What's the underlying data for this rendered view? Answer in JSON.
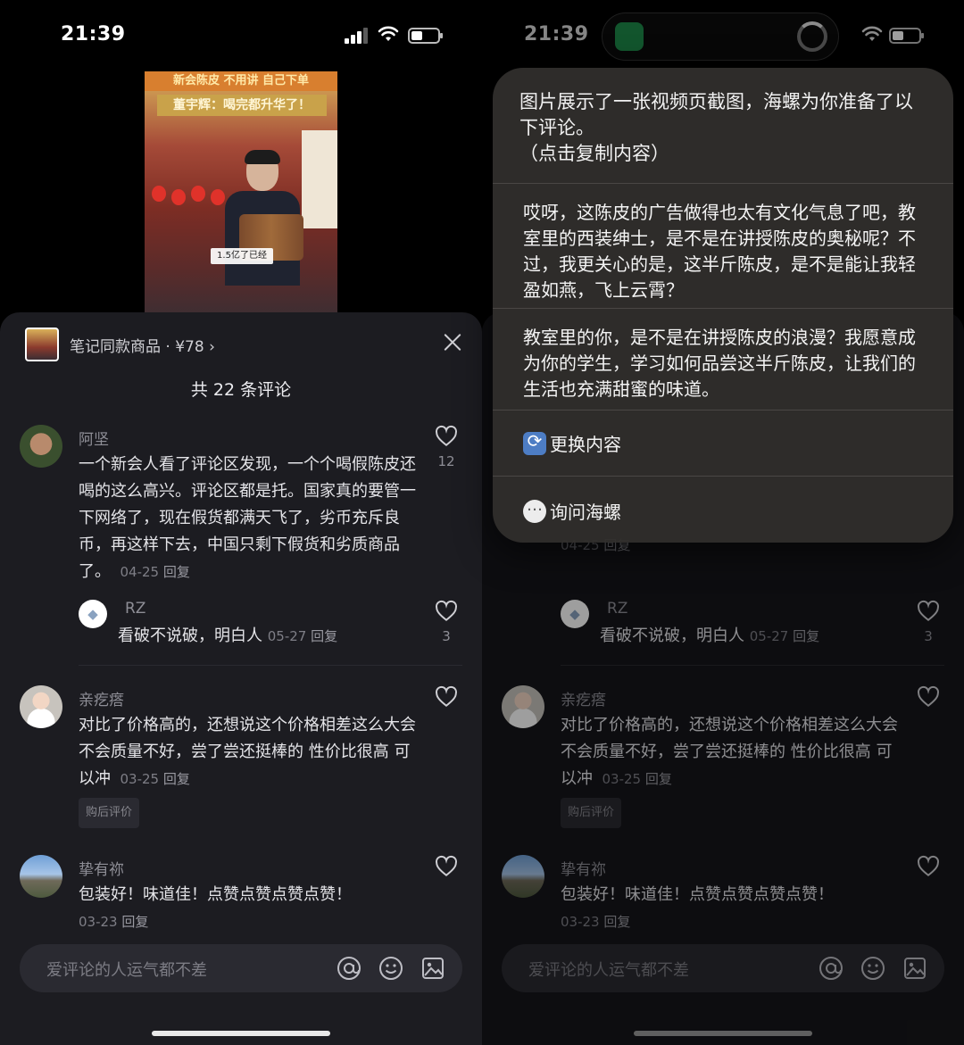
{
  "status": {
    "time": "21:39"
  },
  "video": {
    "banner": "新会陈皮 不用讲 自己下单",
    "title": "董宇辉：喝完都升华了！",
    "caption": "1.5亿了已经"
  },
  "sheet": {
    "product_label": "笔记同款商品 · ¥78 ›",
    "comment_count": "共 22 条评论",
    "comments": [
      {
        "author": "阿坚",
        "text": "一个新会人看了评论区发现，一个个喝假陈皮还喝的这么高兴。评论区都是托。国家真的要管一下网络了，现在假货都满天飞了，劣币充斥良币，再这样下去，中国只剩下假货和劣质商品了。",
        "date": "04-25",
        "reply": "回复",
        "likes": "12"
      },
      {
        "author": "亲疙瘩",
        "text": "对比了价格高的，还想说这个价格相差这么大会不会质量不好，尝了尝还挺棒的 性价比很高 可以冲",
        "date": "03-25",
        "reply": "回复",
        "badge": "购后评价"
      },
      {
        "author": "挚有祢",
        "text": "包装好！味道佳！点赞点赞点赞点赞！",
        "date": "03-23",
        "reply": "回复"
      }
    ],
    "sub_reply": {
      "author": "RZ",
      "text": "看破不说破，明白人",
      "date": "05-27",
      "reply": "回复",
      "likes": "3"
    },
    "input_placeholder": "爱评论的人运气都不差"
  },
  "popup": {
    "header": "图片展示了一张视频页截图，海螺为你准备了以下评论。\n（点击复制内容）",
    "suggestions": [
      "哎呀，这陈皮的广告做得也太有文化气息了吧，教室里的西装绅士，是不是在讲授陈皮的奥秘呢？不过，我更关心的是，这半斤陈皮，是不是能让我轻盈如燕，飞上云霄？",
      "教室里的你，是不是在讲授陈皮的浪漫？我愿意成为你的学生，学习如何品尝这半斤陈皮，让我们的生活也充满甜蜜的味道。"
    ],
    "refresh_label": "更换内容",
    "ask_label": "询问海螺"
  },
  "colors": {
    "sheet_bg": "#1c1c21",
    "popup_bg": "#302e2c",
    "island_app": "#1d8a4a"
  }
}
